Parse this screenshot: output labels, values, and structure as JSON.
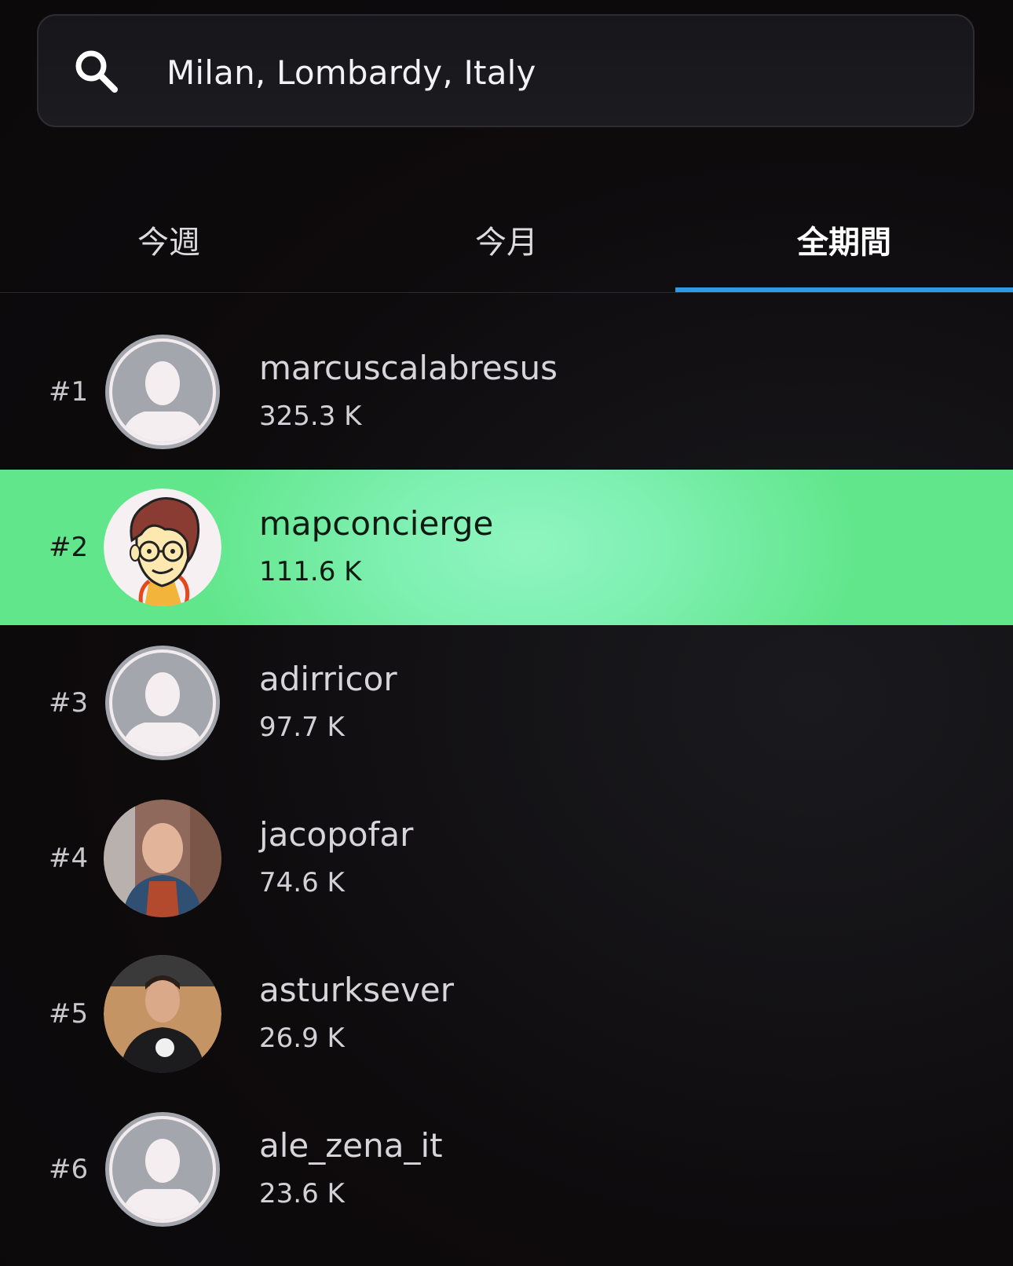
{
  "search": {
    "value": "Milan, Lombardy, Italy",
    "icon": "search-icon"
  },
  "tabs": [
    {
      "label": "今週",
      "active": false
    },
    {
      "label": "今月",
      "active": false
    },
    {
      "label": "全期間",
      "active": true
    }
  ],
  "colors": {
    "accent": "#2b9be8",
    "highlight": "#7ff0b2",
    "background": "#0d0a0c"
  },
  "leaderboard": [
    {
      "rank": "#1",
      "username": "marcuscalabresus",
      "score": "325.3 K",
      "avatar": "default-avatar-icon",
      "highlighted": false
    },
    {
      "rank": "#2",
      "username": "mapconcierge",
      "score": "111.6 K",
      "avatar": "cartoon-avatar",
      "highlighted": true
    },
    {
      "rank": "#3",
      "username": "adirricor",
      "score": "97.7 K",
      "avatar": "default-avatar-icon",
      "highlighted": false
    },
    {
      "rank": "#4",
      "username": "jacopofar",
      "score": "74.6 K",
      "avatar": "photo-avatar",
      "highlighted": false
    },
    {
      "rank": "#5",
      "username": "asturksever",
      "score": "26.9 K",
      "avatar": "photo-avatar",
      "highlighted": false
    },
    {
      "rank": "#6",
      "username": "ale_zena_it",
      "score": "23.6 K",
      "avatar": "default-avatar-icon",
      "highlighted": false
    }
  ]
}
